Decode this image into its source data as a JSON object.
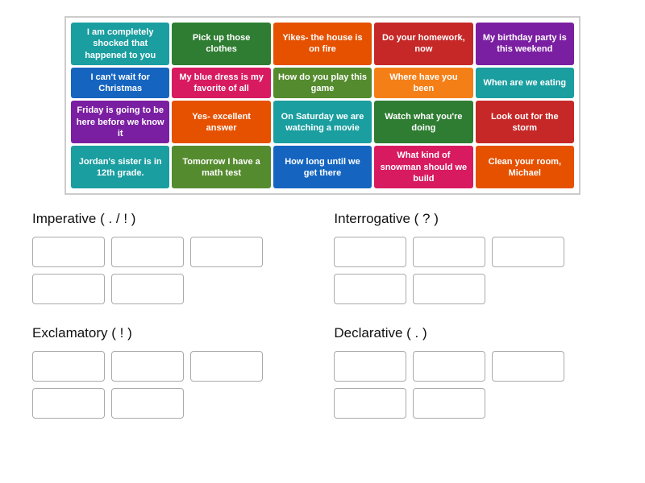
{
  "cards": [
    {
      "text": "I am completely shocked that happened to you",
      "color": "teal"
    },
    {
      "text": "Pick up those clothes",
      "color": "green"
    },
    {
      "text": "Yikes- the house is on fire",
      "color": "orange"
    },
    {
      "text": "Do your homework, now",
      "color": "red"
    },
    {
      "text": "My birthday party is this weekend",
      "color": "purple"
    },
    {
      "text": "I can't wait for Christmas",
      "color": "blue"
    },
    {
      "text": "My blue dress is my favorite of all",
      "color": "pink"
    },
    {
      "text": "How do you play this game",
      "color": "lime"
    },
    {
      "text": "Where have you been",
      "color": "amber"
    },
    {
      "text": "When are we eating",
      "color": "teal"
    },
    {
      "text": "Friday is going to be here before we know it",
      "color": "purple"
    },
    {
      "text": "Yes- excellent answer",
      "color": "orange"
    },
    {
      "text": "On Saturday we are watching a movie",
      "color": "teal"
    },
    {
      "text": "Watch what you're doing",
      "color": "green"
    },
    {
      "text": "Look out for the storm",
      "color": "red"
    },
    {
      "text": "Jordan's sister is in 12th grade.",
      "color": "teal"
    },
    {
      "text": "Tomorrow I have a math test",
      "color": "lime"
    },
    {
      "text": "How long until we get there",
      "color": "blue"
    },
    {
      "text": "What kind of snowman should we build",
      "color": "pink"
    },
    {
      "text": "Clean your room, Michael",
      "color": "orange"
    }
  ],
  "categories": [
    {
      "title": "Imperative ( . / ! )",
      "rows": [
        3,
        2
      ]
    },
    {
      "title": "Interrogative ( ? )",
      "rows": [
        3,
        2
      ]
    },
    {
      "title": "Exclamatory ( ! )",
      "rows": [
        3,
        2
      ]
    },
    {
      "title": "Declarative ( . )",
      "rows": [
        3,
        2
      ]
    }
  ]
}
